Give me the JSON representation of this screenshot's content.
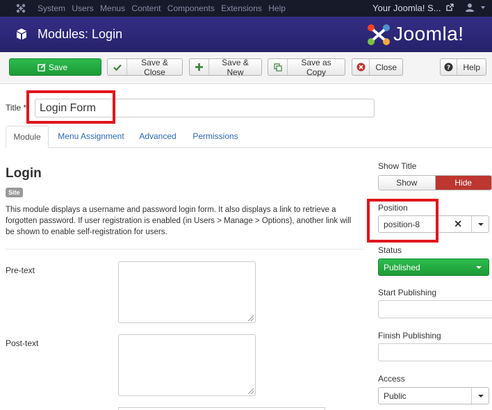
{
  "topbar": {
    "menu": [
      "System",
      "Users",
      "Menus",
      "Content",
      "Components",
      "Extensions",
      "Help"
    ],
    "site_link": "Your Joomla! S..."
  },
  "header": {
    "title": "Modules: Login",
    "brand": "Joomla!"
  },
  "toolbar": {
    "save": "Save",
    "save_close": "Save & Close",
    "save_new": "Save & New",
    "save_copy": "Save as Copy",
    "close": "Close",
    "help": "Help"
  },
  "form": {
    "title_label": "Title *",
    "title_value": "Login Form"
  },
  "tabs": [
    "Module",
    "Menu Assignment",
    "Advanced",
    "Permissions"
  ],
  "module": {
    "heading": "Login",
    "badge": "Site",
    "description": "This module displays a username and password login form. It also displays a link to retrieve a forgotten password. If user registration is enabled (in Users > Manage > Options), another link will be shown to enable self-registration for users.",
    "pre_text_label": "Pre-text",
    "post_text_label": "Post-text"
  },
  "sidebar": {
    "show_title_label": "Show Title",
    "show": "Show",
    "hide": "Hide",
    "position_label": "Position",
    "position_value": "position-8",
    "status_label": "Status",
    "status_value": "Published",
    "start_label": "Start Publishing",
    "finish_label": "Finish Publishing",
    "access_label": "Access",
    "access_value": "Public"
  },
  "colors": {
    "header_bg": "#2e2a7a",
    "save_green": "#1d9a37",
    "hide_red": "#bd362f",
    "highlight_red": "#e0161c",
    "link_blue": "#2a69b8"
  }
}
